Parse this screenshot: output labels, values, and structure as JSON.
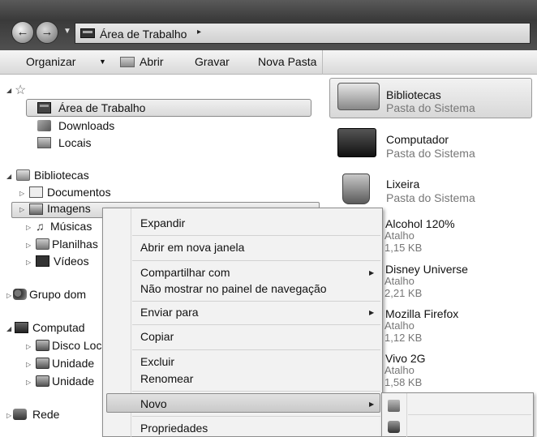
{
  "address": {
    "back_icon": "back-arrow-icon",
    "forward_icon": "forward-arrow-icon",
    "path": "Área de Trabalho",
    "separator": "▸"
  },
  "toolbar": {
    "organize": "Organizar",
    "open": "Abrir",
    "burn": "Gravar",
    "new_folder": "Nova Pasta"
  },
  "nav": {
    "favorites_icon": "star-icon",
    "desktop": "Área de Trabalho",
    "downloads": "Downloads",
    "places": "Locais",
    "libraries": "Bibliotecas",
    "documents": "Documentos",
    "images": "Imagens",
    "music": "Músicas",
    "spreadsheets": "Planilhas",
    "videos": "Vídeos",
    "homegroup": "Grupo dom",
    "computer": "Computad",
    "local_disk": "Disco Loc",
    "drive1": "Unidade",
    "drive2": "Unidade",
    "network": "Rede"
  },
  "content": {
    "items": [
      {
        "name": "Bibliotecas",
        "type": "Pasta do Sistema"
      },
      {
        "name": "Computador",
        "type": "Pasta do Sistema"
      },
      {
        "name": "Lixeira",
        "type": "Pasta do Sistema"
      },
      {
        "name": "Alcohol 120%",
        "type": "Atalho",
        "size": "1,15 KB"
      },
      {
        "name": "Disney Universe",
        "type": "Atalho",
        "size": "2,21 KB"
      },
      {
        "name": "Mozilla Firefox",
        "type": "Atalho",
        "size": "1,12 KB"
      },
      {
        "name": "Vivo 2G",
        "type": "Atalho",
        "size": "1,58 KB"
      }
    ]
  },
  "context_menu": {
    "expand": "Expandir",
    "open_new_window": "Abrir em nova janela",
    "share_with": "Compartilhar com",
    "hide_in_nav": "Não mostrar no painel de navegação",
    "send_to": "Enviar para",
    "copy": "Copiar",
    "delete": "Excluir",
    "rename": "Renomear",
    "new": "Novo",
    "properties": "Propriedades",
    "submenu_arrow": "▶"
  },
  "colors": {
    "address_bar": "#3f3f3f",
    "toolbar": "#e4e4e4",
    "selection": "#dcdcdc",
    "menu_bg": "#f2f2f2"
  }
}
